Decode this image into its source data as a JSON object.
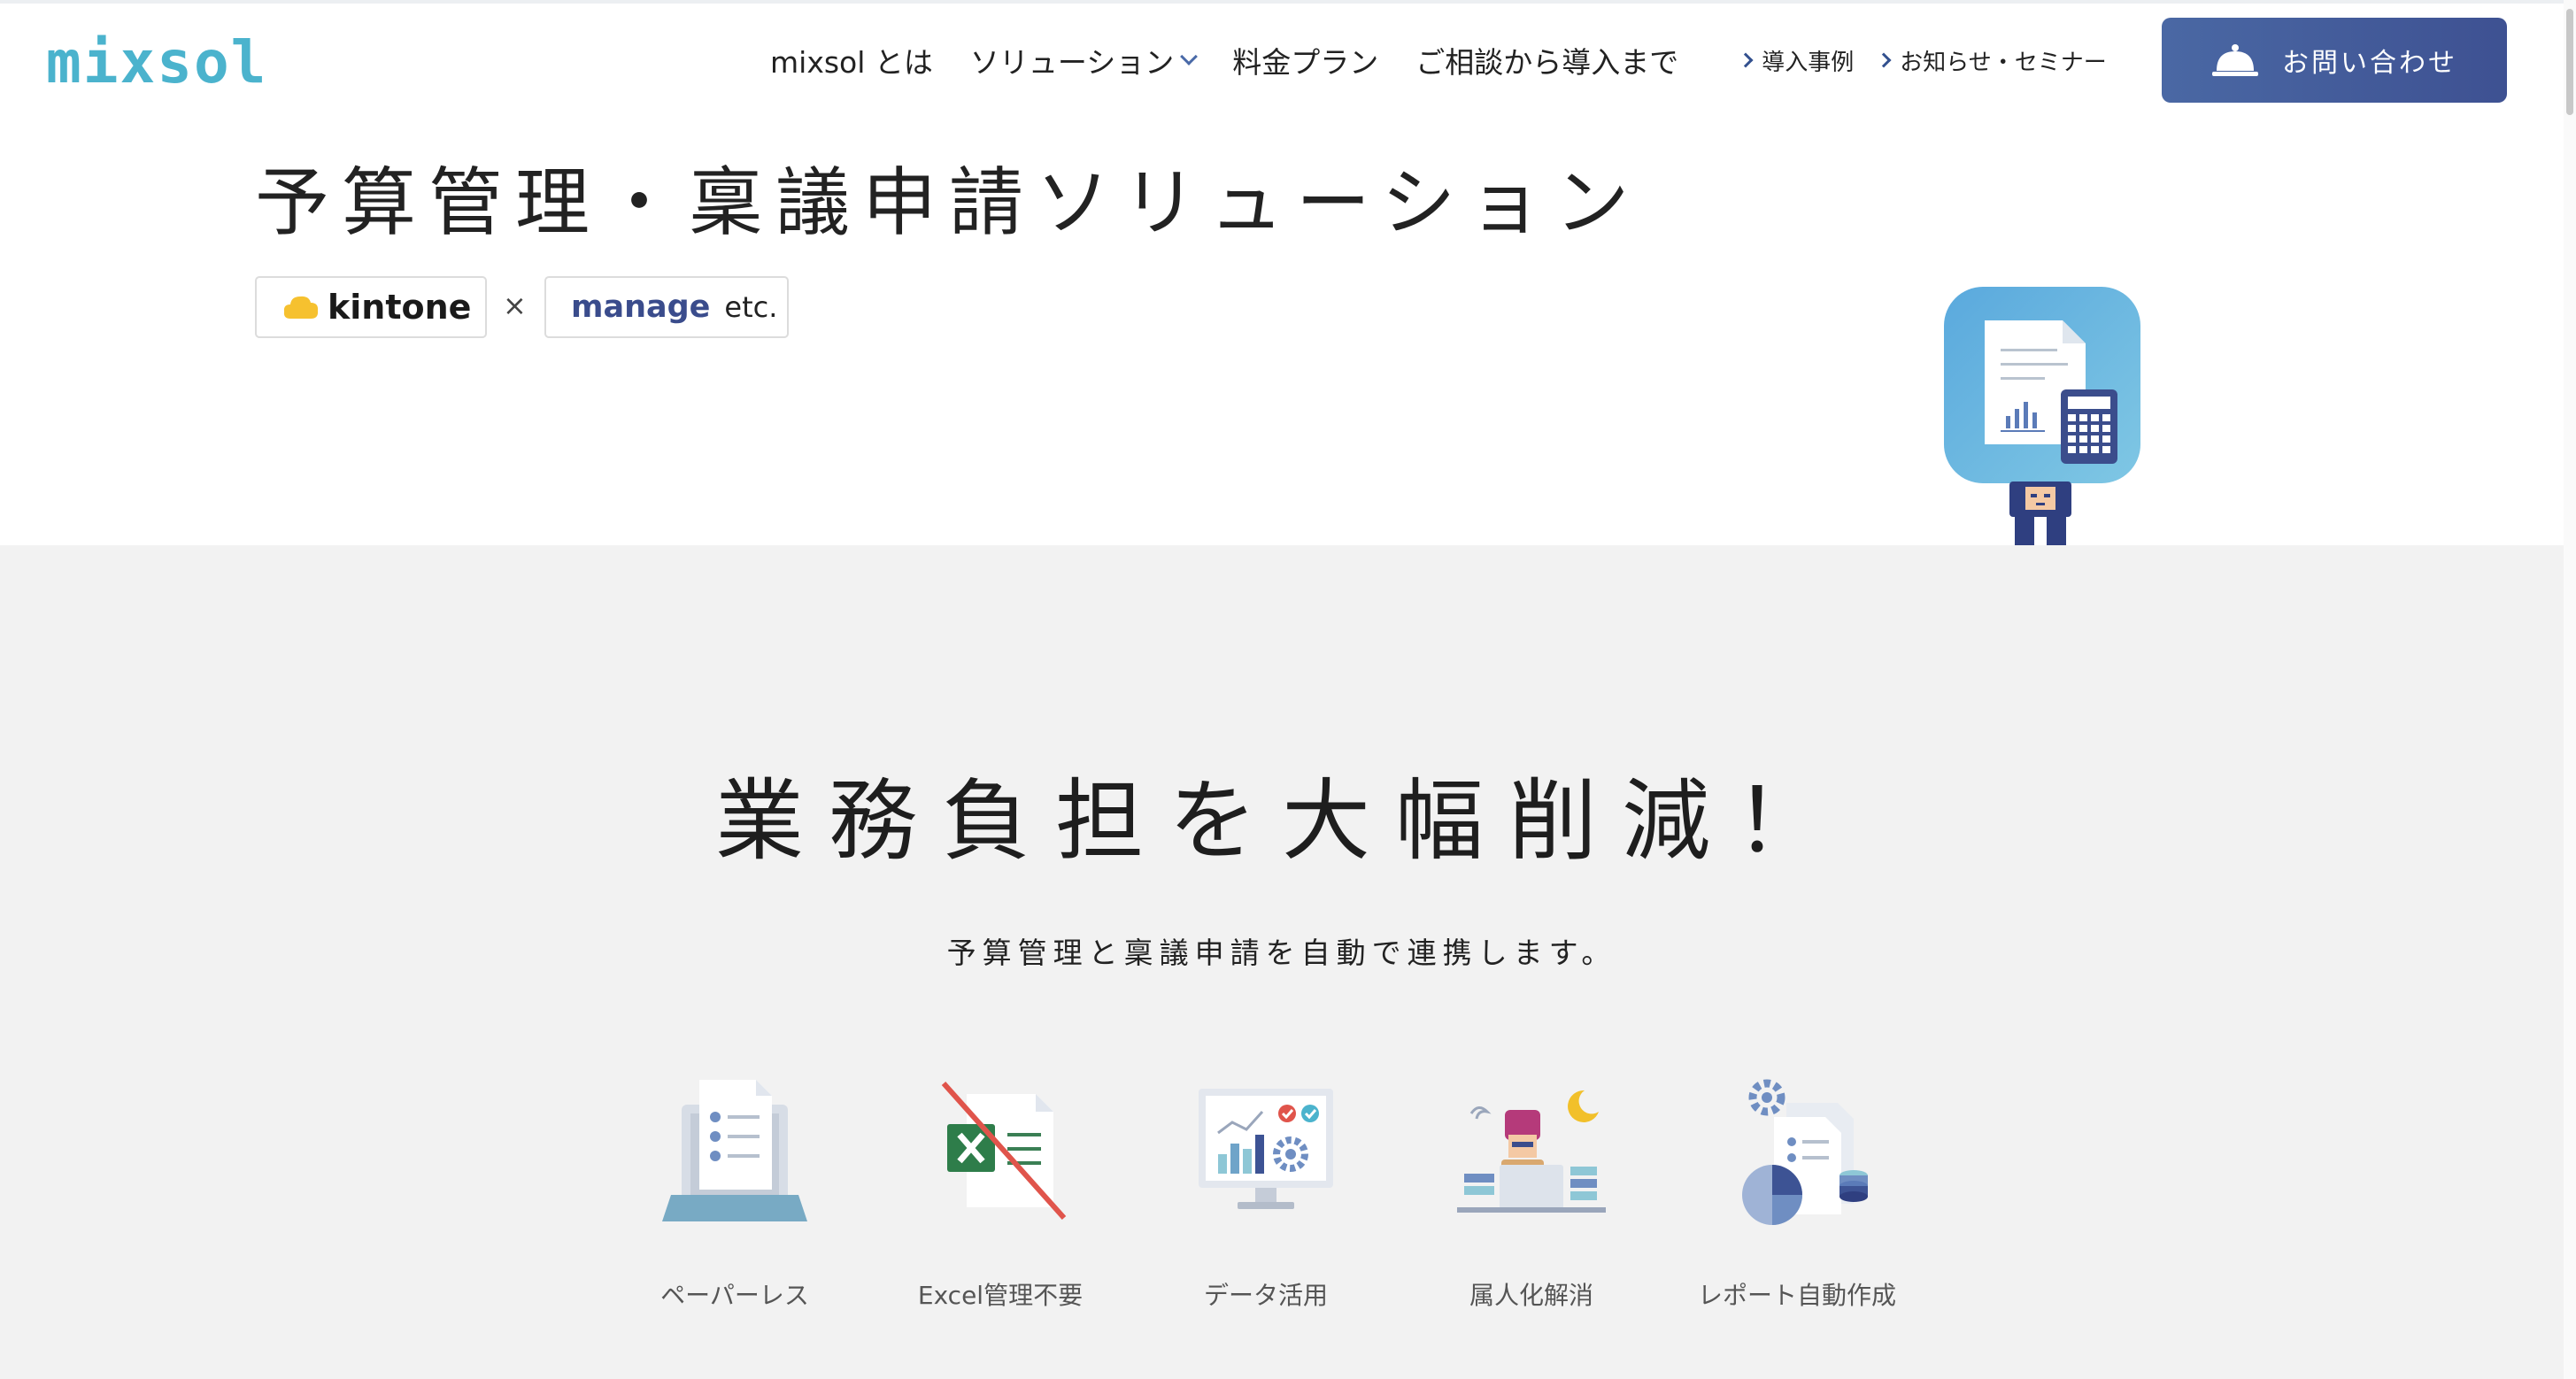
{
  "header": {
    "logo": "mixsol",
    "nav": [
      {
        "label": "mixsol とは"
      },
      {
        "label": "ソリューション",
        "has_dropdown": true
      },
      {
        "label": "料金プラン"
      },
      {
        "label": "ご相談から導入まで"
      }
    ],
    "sub_nav": [
      {
        "label": "導入事例"
      },
      {
        "label": "お知らせ・セミナー"
      }
    ],
    "contact_button": "お問い合わせ"
  },
  "hero": {
    "title": "予算管理・稟議申請ソリューション",
    "badge_kintone": "kintone",
    "times": "×",
    "badge_manage": "manage",
    "badge_etc": "etc."
  },
  "section": {
    "title": "業務負担を大幅削減！",
    "subtitle": "予算管理と稟議申請を自動で連携します。",
    "features": [
      {
        "label": "ペーパーレス",
        "icon": "paperless-icon"
      },
      {
        "label": "Excel管理不要",
        "icon": "no-excel-icon"
      },
      {
        "label": "データ活用",
        "icon": "data-utilization-icon"
      },
      {
        "label": "属人化解消",
        "icon": "personalization-resolution-icon"
      },
      {
        "label": "レポート自動作成",
        "icon": "auto-report-icon"
      }
    ]
  },
  "colors": {
    "brand": "#4bb3cd",
    "accent": "#3e5192",
    "section_bg": "#f2f2f2"
  }
}
